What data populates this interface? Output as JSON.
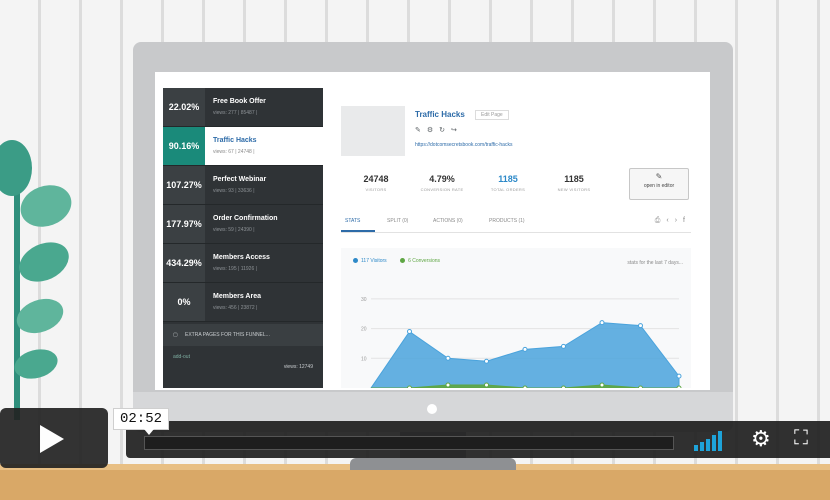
{
  "sidebar": {
    "steps": [
      {
        "pct": "22.02%",
        "name": "Free Book Offer",
        "sub": "views: 277 | 85487 |"
      },
      {
        "pct": "90.16%",
        "name": "Traffic Hacks",
        "sub": "views: 67 | 24748 |"
      },
      {
        "pct": "107.27%",
        "name": "Perfect Webinar",
        "sub": "views: 93 | 33636 |"
      },
      {
        "pct": "177.97%",
        "name": "Order Confirmation",
        "sub": "views: 59 | 24390 |"
      },
      {
        "pct": "434.29%",
        "name": "Members Access",
        "sub": "views: 195 | 11926 |"
      },
      {
        "pct": "0%",
        "name": "Members Area",
        "sub": "views: 456 | 23872 |"
      }
    ],
    "extra_pages": "EXTRA PAGES FOR THIS FUNNEL...",
    "add_out": "add-out",
    "views_total": "views: 12749"
  },
  "page": {
    "title": "Traffic Hacks",
    "badge": "Edit Page",
    "url": "https://dotcomsecretsbook.com/traffic-hacks",
    "editor_button": "open in editor"
  },
  "stats": [
    {
      "value": "24748",
      "label": "VISITORS"
    },
    {
      "value": "4.79%",
      "label": "CONVERSION RATE"
    },
    {
      "value": "1185",
      "label": "TOTAL ORDERS"
    },
    {
      "value": "1185",
      "label": "NEW VISITORS"
    }
  ],
  "tabs": [
    "STATS",
    "SPLIT (0)",
    "ACTIONS (0)",
    "PRODUCTS (1)"
  ],
  "legend": {
    "visitors": "117 Visitors",
    "conversions": "6 Conversions",
    "note": "stats for the last 7 days..."
  },
  "chart_data": {
    "type": "area",
    "yticks": [
      30,
      20,
      10
    ],
    "ylim": [
      0,
      35
    ],
    "x": [
      1,
      2,
      3,
      4,
      5,
      6,
      7,
      8,
      9
    ],
    "series": [
      {
        "name": "117 Visitors",
        "values": [
          0,
          19,
          10,
          9,
          13,
          14,
          22,
          21,
          4
        ]
      },
      {
        "name": "6 Conversions",
        "values": [
          0,
          0,
          1,
          1,
          0,
          0,
          1,
          0,
          0
        ]
      }
    ],
    "colors": {
      "visitors": "#4aa3dc",
      "conversions": "#5ea643"
    }
  },
  "player": {
    "time": "02:52",
    "progress": 0.0
  },
  "colors": {
    "accent": "#1a8a7a",
    "link": "#2d6ba8",
    "volume": "#1ea3d9"
  }
}
